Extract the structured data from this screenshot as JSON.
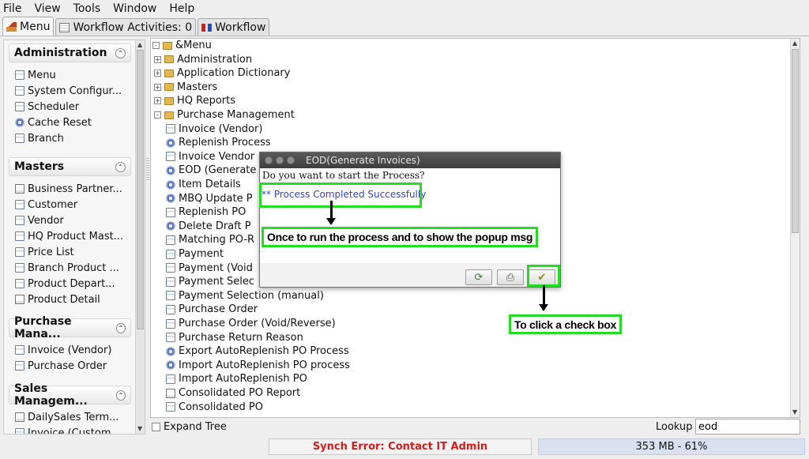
{
  "menubar": {
    "items": [
      "File",
      "View",
      "Tools",
      "Window",
      "Help"
    ]
  },
  "tabs": [
    {
      "label": "Menu",
      "icon": "home-icon",
      "active": true
    },
    {
      "label": "Workflow Activities: 0",
      "icon": "calendar-icon",
      "active": false
    },
    {
      "label": "Workflow",
      "icon": "workflow-icon",
      "active": false
    }
  ],
  "sidebar": {
    "groups": [
      {
        "title": "Administration",
        "items": [
          {
            "label": "Menu",
            "icon": "window-icon"
          },
          {
            "label": "System Configur...",
            "icon": "window-icon"
          },
          {
            "label": "Scheduler",
            "icon": "window-icon"
          },
          {
            "label": "Cache Reset",
            "icon": "gear-icon"
          },
          {
            "label": "Branch",
            "icon": "window-icon"
          }
        ]
      },
      {
        "title": "Masters",
        "items": [
          {
            "label": "Business Partner...",
            "icon": "report-icon"
          },
          {
            "label": "Customer",
            "icon": "window-icon"
          },
          {
            "label": "Vendor",
            "icon": "window-icon"
          },
          {
            "label": "HQ Product Mast...",
            "icon": "window-icon"
          },
          {
            "label": "Price List",
            "icon": "window-icon"
          },
          {
            "label": "Branch Product ...",
            "icon": "window-icon"
          },
          {
            "label": "Product Depart...",
            "icon": "window-icon"
          },
          {
            "label": "Product Detail",
            "icon": "report-icon"
          }
        ]
      },
      {
        "title": "Purchase Mana...",
        "items": [
          {
            "label": "Invoice (Vendor)",
            "icon": "window-icon"
          },
          {
            "label": "Purchase Order",
            "icon": "window-icon"
          }
        ]
      },
      {
        "title": "Sales Managem...",
        "items": [
          {
            "label": "DailySales Term...",
            "icon": "report-icon"
          },
          {
            "label": "Invoice (Custom...",
            "icon": "window-icon"
          }
        ]
      }
    ]
  },
  "tree": {
    "root": "&Menu",
    "nodes": [
      {
        "label": "Administration",
        "type": "folder",
        "expander": "+"
      },
      {
        "label": "Application Dictionary",
        "type": "folder",
        "expander": "+"
      },
      {
        "label": "Masters",
        "type": "folder",
        "expander": "+"
      },
      {
        "label": "HQ Reports",
        "type": "folder",
        "expander": "+"
      },
      {
        "label": "Purchase Management",
        "type": "folder-open",
        "expander": "-"
      },
      {
        "label": "Invoice (Vendor)",
        "type": "window"
      },
      {
        "label": "Replenish Process",
        "type": "process"
      },
      {
        "label": "Invoice Vendor",
        "type": "window"
      },
      {
        "label": "EOD (Generate",
        "type": "process"
      },
      {
        "label": "Item Details",
        "type": "process"
      },
      {
        "label": "MBQ Update P",
        "type": "process"
      },
      {
        "label": "Replenish PO",
        "type": "window"
      },
      {
        "label": "Delete Draft P",
        "type": "process"
      },
      {
        "label": "Matching PO-R",
        "type": "window"
      },
      {
        "label": "Payment",
        "type": "window"
      },
      {
        "label": "Payment (Void",
        "type": "window"
      },
      {
        "label": "Payment Selec",
        "type": "window"
      },
      {
        "label": "Payment Selection (manual)",
        "type": "window"
      },
      {
        "label": "Purchase Order",
        "type": "window"
      },
      {
        "label": "Purchase Order (Void/Reverse)",
        "type": "window"
      },
      {
        "label": "Purchase Return Reason",
        "type": "window"
      },
      {
        "label": "Export AutoReplenish PO Process",
        "type": "process"
      },
      {
        "label": "Import AutoReplenish PO process",
        "type": "process"
      },
      {
        "label": "Import AutoReplenish PO",
        "type": "window"
      },
      {
        "label": "Consolidated PO Report",
        "type": "report"
      },
      {
        "label": "Consolidated PO",
        "type": "window"
      }
    ],
    "expand_tree_label": "Expand Tree",
    "lookup_label": "Lookup",
    "lookup_value": "eod"
  },
  "dialog": {
    "title": "EOD(Generate Invoices)",
    "question": "Do you want to start the Process?",
    "message": "** Process Completed Successfully",
    "buttons": [
      {
        "name": "refresh-button",
        "glyph": "⟳",
        "icon": "refresh-icon"
      },
      {
        "name": "print-button",
        "glyph": "⎙",
        "icon": "print-icon"
      },
      {
        "name": "ok-button",
        "glyph": "✔",
        "icon": "checkmark-icon"
      }
    ]
  },
  "annotations": {
    "callout_run": "Once to run the process and to show the popup msg",
    "callout_check": "To click a check box"
  },
  "status": {
    "sync_error": "Synch Error: Contact IT Admin",
    "memory": "353 MB - 61%"
  },
  "colors": {
    "highlight": "#22dd22",
    "error": "#d21d1d",
    "message": "#3344cc"
  }
}
